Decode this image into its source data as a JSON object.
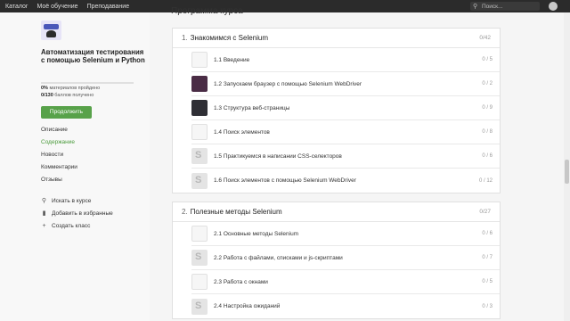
{
  "topbar": {
    "nav": [
      "Каталог",
      "Моё обучение",
      "Преподавание"
    ],
    "search_placeholder": "Поиск..."
  },
  "sidebar": {
    "course_title": "Автоматизация тестирования с помощью Selenium и Python",
    "materials_pct": "0%",
    "materials_text": " материалов пройдено",
    "points": "0/130",
    "points_text": " баллов получено",
    "progress_fraction": 0,
    "continue_label": "Продолжить",
    "links": [
      "Описание",
      "Содержание",
      "Новости",
      "Комментарии",
      "Отзывы"
    ],
    "active_link": "Содержание",
    "actions": [
      {
        "label": "Искать в курсе",
        "icon": "search-icon"
      },
      {
        "label": "Добавить в избранные",
        "icon": "bookmark-icon"
      },
      {
        "label": "Создать класс",
        "icon": "plus-icon"
      }
    ]
  },
  "main": {
    "program_title": "Программа курса",
    "modules": [
      {
        "num": "1.",
        "title": "Знакомимся с Selenium",
        "count": "0/42",
        "lessons": [
          {
            "title": "1.1 Введение",
            "count": "0 / 5",
            "thumb": "light"
          },
          {
            "title": "1.2 Запускаем браузер с помощью Selenium WebDriver",
            "count": "0 / 2",
            "thumb": "purple"
          },
          {
            "title": "1.3 Структура веб-страницы",
            "count": "0 / 9",
            "thumb": "dark"
          },
          {
            "title": "1.4 Поиск элементов",
            "count": "0 / 8",
            "thumb": "light"
          },
          {
            "title": "1.5 Практикуемся в написании CSS-селекторов",
            "count": "0 / 6",
            "thumb": "placeholder"
          },
          {
            "title": "1.6 Поиск элементов с помощью Selenium WebDriver",
            "count": "0 / 12",
            "thumb": "placeholder"
          }
        ]
      },
      {
        "num": "2.",
        "title": "Полезные методы Selenium",
        "count": "0/27",
        "lessons": [
          {
            "title": "2.1 Основные методы Selenium",
            "count": "0 / 6",
            "thumb": "light"
          },
          {
            "title": "2.2 Работа с файлами, списками и js-скриптами",
            "count": "0 / 7",
            "thumb": "placeholder"
          },
          {
            "title": "2.3 Работа с окнами",
            "count": "0 / 5",
            "thumb": "light"
          },
          {
            "title": "2.4 Настройка ожиданий",
            "count": "0 / 3",
            "thumb": "placeholder"
          }
        ]
      }
    ]
  },
  "colors": {
    "accent_green": "#58a24a",
    "topbar": "#2b2b2b"
  }
}
